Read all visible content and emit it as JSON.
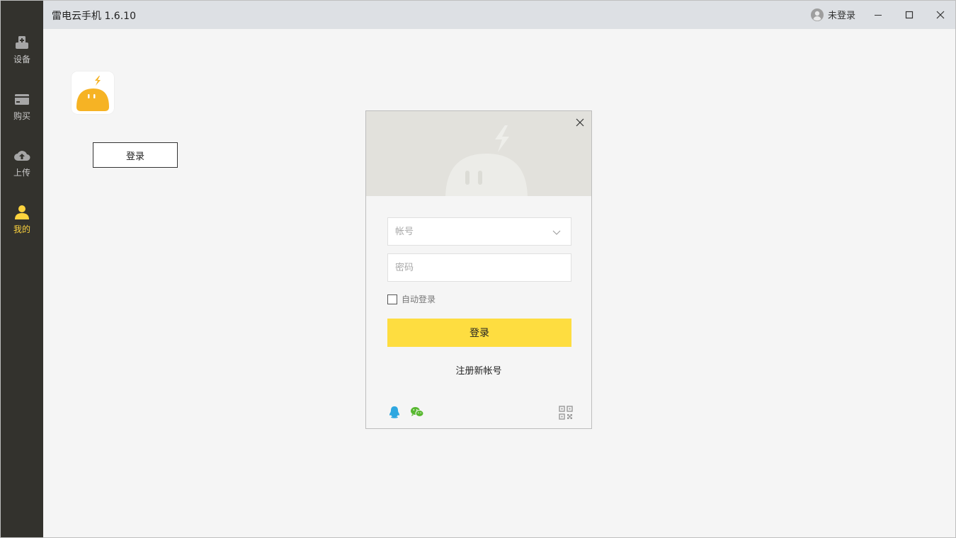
{
  "window": {
    "title": "雷电云手机 1.6.10"
  },
  "titlebar": {
    "user_status": "未登录",
    "minimize_icon": "minimize-icon",
    "maximize_icon": "maximize-icon",
    "close_icon": "close-icon"
  },
  "sidebar": {
    "items": [
      {
        "label": "设备",
        "icon": "device-icon",
        "active": false
      },
      {
        "label": "购买",
        "icon": "card-icon",
        "active": false
      },
      {
        "label": "上传",
        "icon": "cloud-upload-icon",
        "active": false
      },
      {
        "label": "我的",
        "icon": "user-icon",
        "active": true
      }
    ],
    "active_color": "#fcd33e"
  },
  "profile": {
    "login_label": "登录"
  },
  "login_dialog": {
    "account_placeholder": "帐号",
    "password_placeholder": "密码",
    "auto_login_label": "自动登录",
    "login_label": "登录",
    "register_label": "注册新帐号",
    "social": [
      "qq-icon",
      "wechat-icon",
      "qrcode-icon"
    ],
    "accent_color": "#fedd40"
  }
}
